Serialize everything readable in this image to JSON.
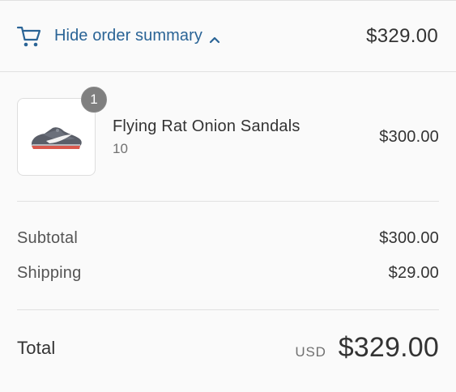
{
  "summary_toggle": {
    "label": "Hide order summary",
    "total": "$329.00",
    "icon": "cart-icon",
    "chevron": "chevron-up-icon",
    "accent_color": "#2a6496"
  },
  "products": [
    {
      "quantity": "1",
      "name": "Flying Rat Onion Sandals",
      "variant": "10",
      "price": "$300.00",
      "image": "gray-sneaker-image"
    }
  ],
  "lines": {
    "subtotal_label": "Subtotal",
    "subtotal_value": "$300.00",
    "shipping_label": "Shipping",
    "shipping_value": "$29.00"
  },
  "total": {
    "label": "Total",
    "currency": "USD",
    "value": "$329.00"
  }
}
